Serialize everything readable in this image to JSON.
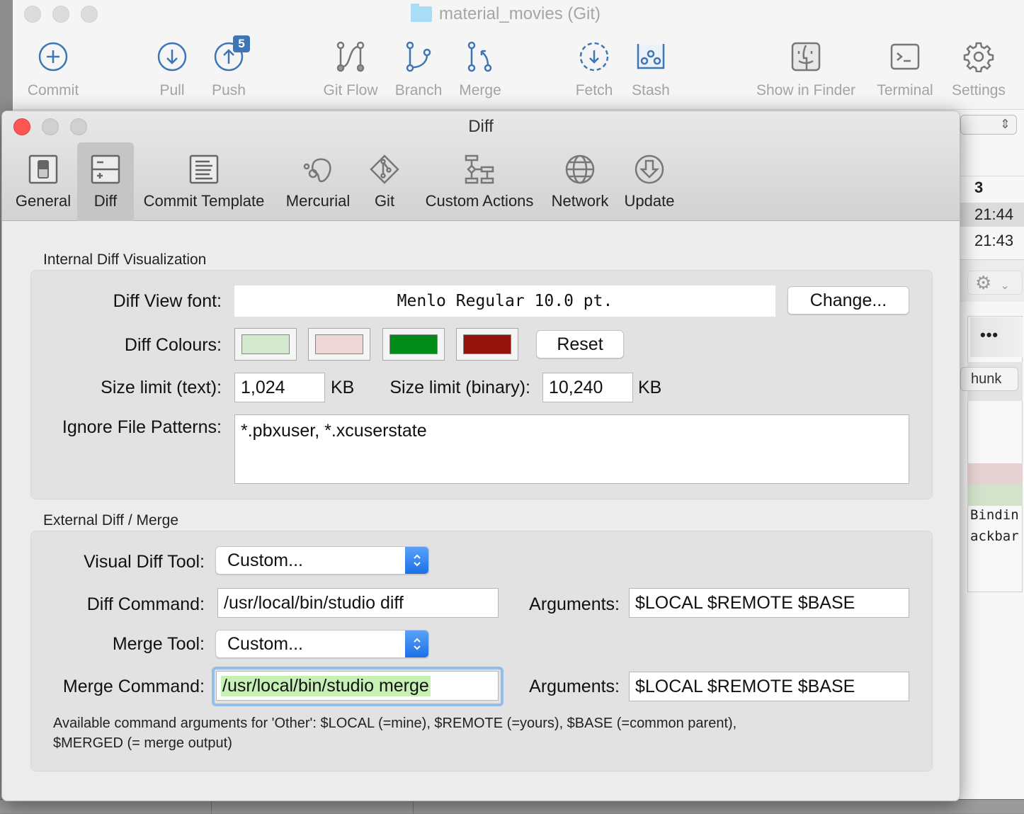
{
  "main_window": {
    "title": "material_movies (Git)",
    "toolbar": [
      {
        "id": "commit",
        "label": "Commit",
        "icon": "plus-circle-icon"
      },
      {
        "id": "pull",
        "label": "Pull",
        "icon": "arrow-down-circle-icon"
      },
      {
        "id": "push",
        "label": "Push",
        "icon": "arrow-up-circle-icon",
        "badge": "5"
      },
      {
        "id": "git-flow",
        "label": "Git Flow",
        "icon": "git-flow-icon"
      },
      {
        "id": "branch",
        "label": "Branch",
        "icon": "branch-icon"
      },
      {
        "id": "merge",
        "label": "Merge",
        "icon": "merge-icon"
      },
      {
        "id": "fetch",
        "label": "Fetch",
        "icon": "fetch-icon"
      },
      {
        "id": "stash",
        "label": "Stash",
        "icon": "stash-icon"
      },
      {
        "id": "show-in-finder",
        "label": "Show in Finder",
        "icon": "finder-icon"
      },
      {
        "id": "terminal",
        "label": "Terminal",
        "icon": "terminal-icon"
      },
      {
        "id": "settings",
        "label": "Settings",
        "icon": "gear-icon"
      }
    ],
    "peek": {
      "row_header": "3",
      "row_times": [
        "21:44",
        "21:43"
      ],
      "more_label": "•••",
      "hunk_label": "hunk",
      "code_lines": [
        "Bindin",
        "ackbar"
      ]
    },
    "colors": {
      "accent": "#3d76b4",
      "badge": "#3d76b4"
    }
  },
  "dialog": {
    "title": "Diff",
    "tabs": [
      {
        "id": "general",
        "label": "General",
        "active": false
      },
      {
        "id": "diff",
        "label": "Diff",
        "active": true
      },
      {
        "id": "commit-template",
        "label": "Commit Template",
        "active": false
      },
      {
        "id": "mercurial",
        "label": "Mercurial",
        "active": false
      },
      {
        "id": "git",
        "label": "Git",
        "active": false
      },
      {
        "id": "custom-actions",
        "label": "Custom Actions",
        "active": false
      },
      {
        "id": "network",
        "label": "Network",
        "active": false
      },
      {
        "id": "update",
        "label": "Update",
        "active": false
      }
    ],
    "internal": {
      "section_title": "Internal Diff Visualization",
      "font_label": "Diff View font:",
      "font_value": "Menlo Regular 10.0 pt.",
      "change_button": "Change...",
      "colours_label": "Diff Colours:",
      "colours": [
        "#d3e8cf",
        "#ecd6d6",
        "#008a17",
        "#94140c"
      ],
      "reset_button": "Reset",
      "size_text_label": "Size limit (text):",
      "size_text_value": "1,024",
      "size_text_unit": "KB",
      "size_binary_label": "Size limit (binary):",
      "size_binary_value": "10,240",
      "size_binary_unit": "KB",
      "ignore_label": "Ignore File Patterns:",
      "ignore_value": "*.pbxuser, *.xcuserstate"
    },
    "external": {
      "section_title": "External Diff / Merge",
      "visual_diff_label": "Visual Diff Tool:",
      "visual_diff_value": "Custom...",
      "diff_command_label": "Diff Command:",
      "diff_command_value": "/usr/local/bin/studio diff",
      "diff_args_label": "Arguments:",
      "diff_args_value": "$LOCAL $REMOTE $BASE",
      "merge_tool_label": "Merge Tool:",
      "merge_tool_value": "Custom...",
      "merge_command_label": "Merge Command:",
      "merge_command_value": "/usr/local/bin/studio merge",
      "merge_args_label": "Arguments:",
      "merge_args_value": "$LOCAL $REMOTE $BASE",
      "hint_line1": "Available command arguments for 'Other': $LOCAL (=mine), $REMOTE (=yours), $BASE (=common parent),",
      "hint_line2": "$MERGED (= merge output)"
    }
  }
}
